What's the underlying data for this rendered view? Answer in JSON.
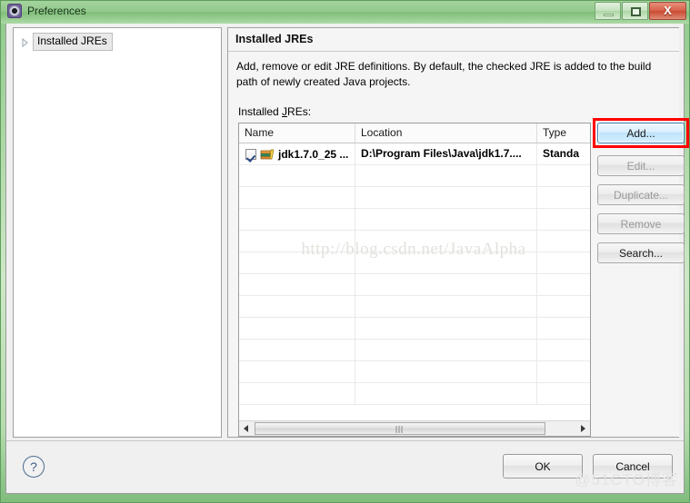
{
  "window": {
    "title": "Preferences",
    "icon": "preferences-gear-icon",
    "controls": {
      "minimize": "minimize-icon",
      "maximize": "restore-icon",
      "close": "X"
    },
    "frame_color": "#8fc98c"
  },
  "sidebar": {
    "items": [
      {
        "label": "Installed JREs",
        "expandable": true,
        "selected": true
      }
    ]
  },
  "content": {
    "title": "Installed JREs",
    "description": "Add, remove or edit JRE definitions. By default, the checked JRE is added to the build path of newly created Java projects.",
    "list_label_prefix": "Installed ",
    "list_label_underlined": "J",
    "list_label_suffix": "REs:"
  },
  "table": {
    "columns": [
      "Name",
      "Location",
      "Type"
    ],
    "rows": [
      {
        "checked": true,
        "icon": "jre-books-icon",
        "name": "jdk1.7.0_25 ...",
        "location": "D:\\Program Files\\Java\\jdk1.7....",
        "type": "Standa"
      }
    ],
    "empty_row_count": 11,
    "watermark": "http://blog.csdn.net/JavaAlpha",
    "scrollbar": {
      "left_arrow": "scroll-left-icon",
      "right_arrow": "scroll-right-icon",
      "grip": "scroll-thumb-grip"
    }
  },
  "side_buttons": [
    {
      "label": "Add...",
      "enabled": true,
      "focused": true,
      "highlighted": true
    },
    {
      "label": "Edit...",
      "enabled": false,
      "mnemonic": "E"
    },
    {
      "label": "Duplicate...",
      "enabled": false,
      "mnemonic": "c"
    },
    {
      "label": "Remove",
      "enabled": false,
      "mnemonic": "R"
    },
    {
      "label": "Search...",
      "enabled": true,
      "mnemonic": "S"
    }
  ],
  "footer": {
    "help": "?",
    "ok": "OK",
    "cancel": "Cancel",
    "watermark": "@51CTO博客"
  },
  "colors": {
    "annotation": "#ff0000",
    "accent": "#3c7fb1",
    "window_green": "#8fc98c",
    "close_red": "#d9624a"
  }
}
